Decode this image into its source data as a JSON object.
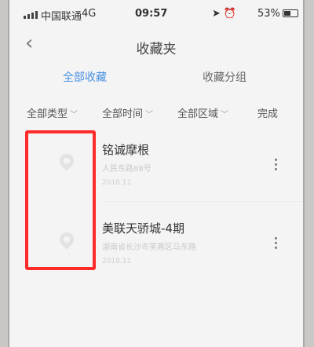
{
  "status_bar": {
    "carrier": "中国联通",
    "network": "4G",
    "time": "09:57",
    "icons": [
      "location-icon",
      "alarm-icon"
    ],
    "battery_percent": "53%",
    "battery_level": 0.53
  },
  "nav": {
    "title": "收藏夹"
  },
  "tabs": [
    {
      "label": "全部收藏",
      "active": true
    },
    {
      "label": "收藏分组",
      "active": false
    }
  ],
  "filters": {
    "type": "全部类型",
    "time": "全部时间",
    "region": "全部区域",
    "done": "完成"
  },
  "items": [
    {
      "name": "铭诚摩根",
      "address": "人民东路88号",
      "date": "2018.11"
    },
    {
      "name": "美联天骄城-4期",
      "address": "湖南省长沙市芙蓉区马东路",
      "date": "2018.11"
    }
  ],
  "colors": {
    "accent": "#4a90e2",
    "highlight": "#ff2a2a"
  }
}
